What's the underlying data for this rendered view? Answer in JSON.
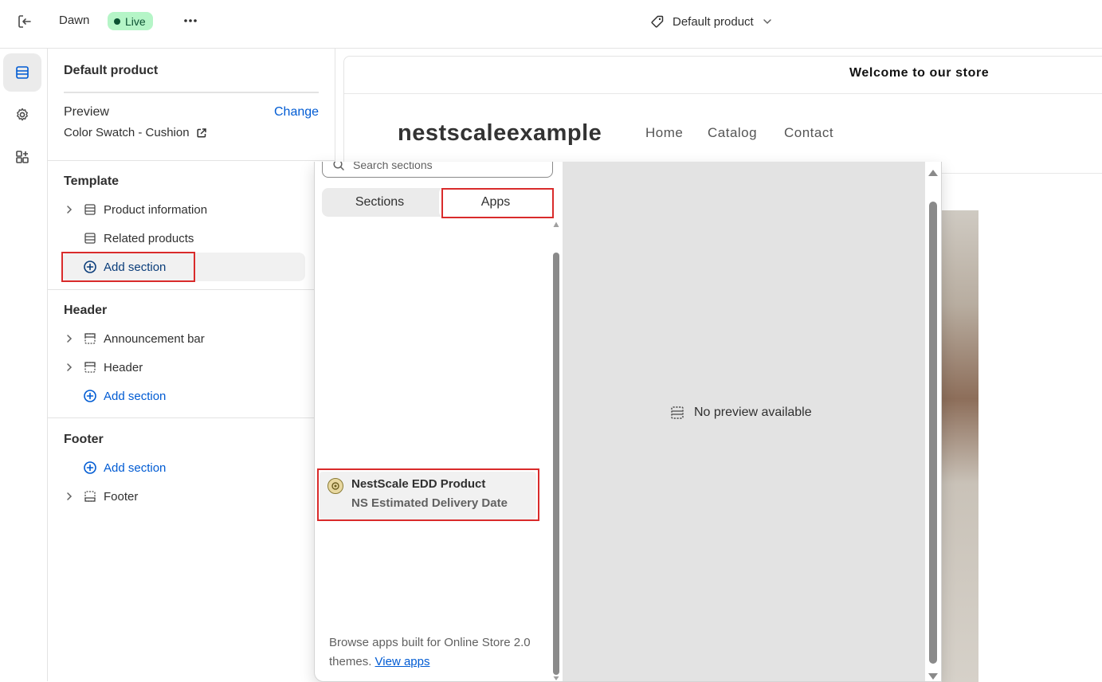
{
  "topbar": {
    "theme_name": "Dawn",
    "live_label": "Live",
    "template_name": "Default product"
  },
  "panel": {
    "title": "Default product",
    "preview_label": "Preview",
    "change_label": "Change",
    "preview_value": "Color Swatch - Cushion",
    "groups": {
      "template": {
        "title": "Template",
        "items": [
          "Product information",
          "Related products"
        ],
        "add_label": "Add section"
      },
      "header": {
        "title": "Header",
        "items": [
          "Announcement bar",
          "Header"
        ],
        "add_label": "Add section"
      },
      "footer": {
        "title": "Footer",
        "add_label": "Add section",
        "items": [
          "Footer"
        ]
      }
    }
  },
  "store": {
    "announcement": "Welcome to our store",
    "name": "nestscaleexample",
    "nav": [
      "Home",
      "Catalog",
      "Contact"
    ]
  },
  "popover": {
    "search_placeholder": "Search sections",
    "tabs": [
      "Sections",
      "Apps"
    ],
    "selected_tab": "Apps",
    "app": {
      "title": "NestScale EDD Product",
      "subtitle": "NS Estimated Delivery Date"
    },
    "browse_text": "Browse apps built for Online Store 2.0 themes.",
    "browse_link": "View apps",
    "no_preview": "No preview available"
  },
  "colors": {
    "link": "#005bd3",
    "live_bg": "#b5f5c7",
    "highlight_red": "#d92b2b"
  }
}
